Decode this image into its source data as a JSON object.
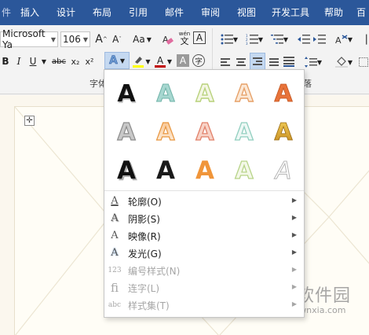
{
  "ribbon_tabs": [
    "件",
    "插入",
    "设计",
    "布局",
    "引用",
    "邮件",
    "审阅",
    "视图",
    "开发工具",
    "帮助",
    "百"
  ],
  "font": {
    "name_value": "Microsoft Ya",
    "size_value": "106",
    "grow_label": "A",
    "shrink_label": "A",
    "change_case_label": "Aa",
    "phonetic_label": "wén",
    "phonetic_char": "文",
    "char_border_label": "A",
    "bold": "B",
    "italic": "I",
    "underline": "U",
    "strike": "abc",
    "subscript": "x₂",
    "superscript": "x²",
    "text_effects": "A",
    "font_color": "A",
    "char_shading": "A",
    "enclose": "字",
    "group_label": "字体"
  },
  "paragraph": {
    "group_label": "落"
  },
  "effects_gallery": {
    "letter": "A",
    "rows": [
      [
        "black-shadow",
        "teal-outline",
        "green-outline",
        "orange-outline",
        "orange-fill"
      ],
      [
        "gray-outline",
        "orange-gradient-outline",
        "red-outline",
        "teal-light-outline",
        "gold-bevel"
      ],
      [
        "black-bold-shadow",
        "black-bold",
        "orange-bold",
        "green-light-outline",
        "white-reflection"
      ]
    ]
  },
  "menu": [
    {
      "label": "轮廓(O)",
      "icon": "A",
      "disabled": false
    },
    {
      "label": "阴影(S)",
      "icon": "A",
      "disabled": false
    },
    {
      "label": "映像(R)",
      "icon": "A",
      "disabled": false
    },
    {
      "label": "发光(G)",
      "icon": "A",
      "disabled": false
    },
    {
      "label": "编号样式(N)",
      "icon": "123",
      "disabled": true
    },
    {
      "label": "连字(L)",
      "icon": "fi",
      "disabled": true
    },
    {
      "label": "样式集(T)",
      "icon": "abc",
      "disabled": true
    }
  ],
  "watermark": {
    "title": "当下软件园",
    "url": "www.downxia.com"
  },
  "colors": {
    "ribbon_blue": "#2b579a",
    "accent_red": "#c00000",
    "highlight_yellow": "#ffff00"
  }
}
